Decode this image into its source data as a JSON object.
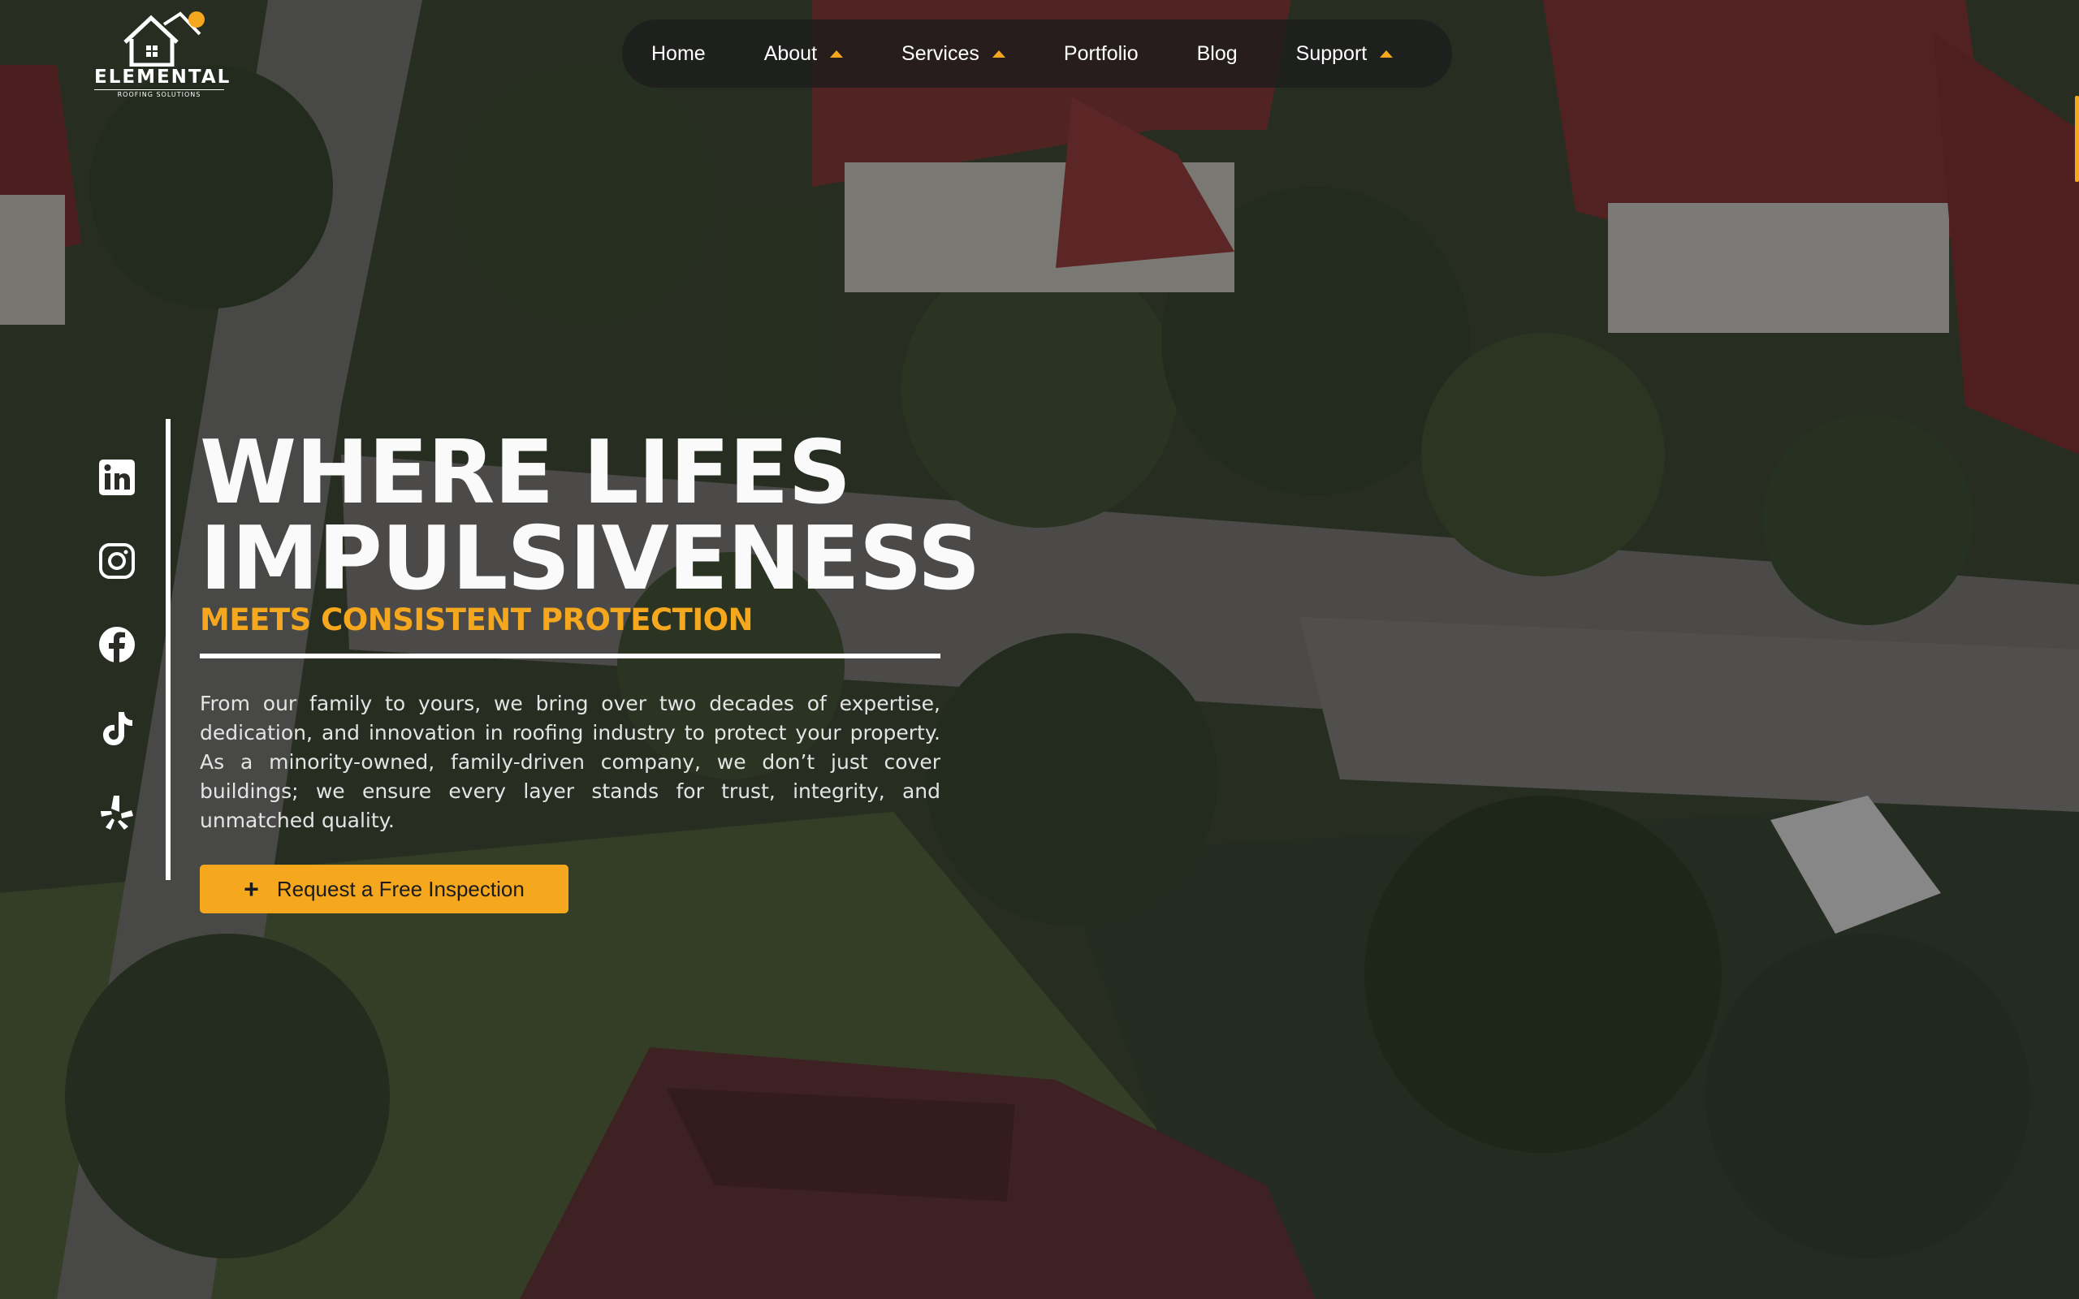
{
  "brand": {
    "name": "ELEMENTAL",
    "tagline": "ROOFING SOLUTIONS"
  },
  "nav": {
    "items": [
      {
        "label": "Home",
        "has_dropdown": false
      },
      {
        "label": "About",
        "has_dropdown": true
      },
      {
        "label": "Services",
        "has_dropdown": true
      },
      {
        "label": "Portfolio",
        "has_dropdown": false
      },
      {
        "label": "Blog",
        "has_dropdown": false
      },
      {
        "label": "Support",
        "has_dropdown": true
      }
    ]
  },
  "social": {
    "icons": [
      "linkedin-icon",
      "instagram-icon",
      "facebook-icon",
      "tiktok-icon",
      "yelp-icon"
    ]
  },
  "hero": {
    "title_line1": "WHERE LIFES",
    "title_line2": "IMPULSIVENESS",
    "subtitle": "MEETS CONSISTENT PROTECTION",
    "body": "From our family to yours, we bring over two decades of expertise, dedication, and innovation in roofing industry to protect your property. As a minority-owned, family-driven company, we don’t just cover buildings; we ensure every layer stands for trust, integrity, and unmatched quality.",
    "cta_label": "Request a Free Inspection"
  },
  "colors": {
    "accent": "#f5a71d",
    "nav_bg": "#1c1c1c",
    "text": "#ffffff"
  }
}
